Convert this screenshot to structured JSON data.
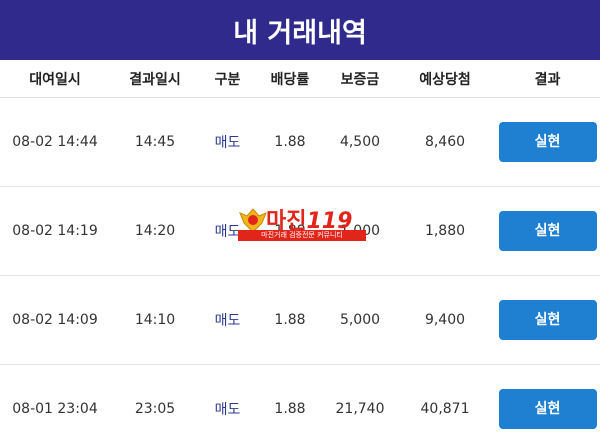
{
  "header": {
    "title": "내 거래내역"
  },
  "table": {
    "columns": [
      "대여일시",
      "결과일시",
      "구분",
      "배당률",
      "보증금",
      "예상당첨",
      "결과"
    ],
    "rows": [
      {
        "rent_time": "08-02 14:44",
        "result_time": "14:45",
        "type": "매도",
        "odds": "1.88",
        "deposit": "4,500",
        "expected": "8,460",
        "result": "실현"
      },
      {
        "rent_time": "08-02 14:19",
        "result_time": "14:20",
        "type": "매도",
        "odds": "1.88",
        "deposit": "1,000",
        "expected": "1,880",
        "result": "실현"
      },
      {
        "rent_time": "08-02 14:09",
        "result_time": "14:10",
        "type": "매도",
        "odds": "1.88",
        "deposit": "5,000",
        "expected": "9,400",
        "result": "실현"
      },
      {
        "rent_time": "08-01 23:04",
        "result_time": "23:05",
        "type": "매도",
        "odds": "1.88",
        "deposit": "21,740",
        "expected": "40,871",
        "result": "실현"
      }
    ]
  },
  "watermark": {
    "main": "마진",
    "num": "119",
    "strip": "마진거래 검증전문 커뮤니티"
  },
  "colors": {
    "header_bg": "#2f2a8c",
    "button_bg": "#1f7fd0",
    "type_text": "#2b3a8f",
    "watermark": "#e1251b"
  }
}
